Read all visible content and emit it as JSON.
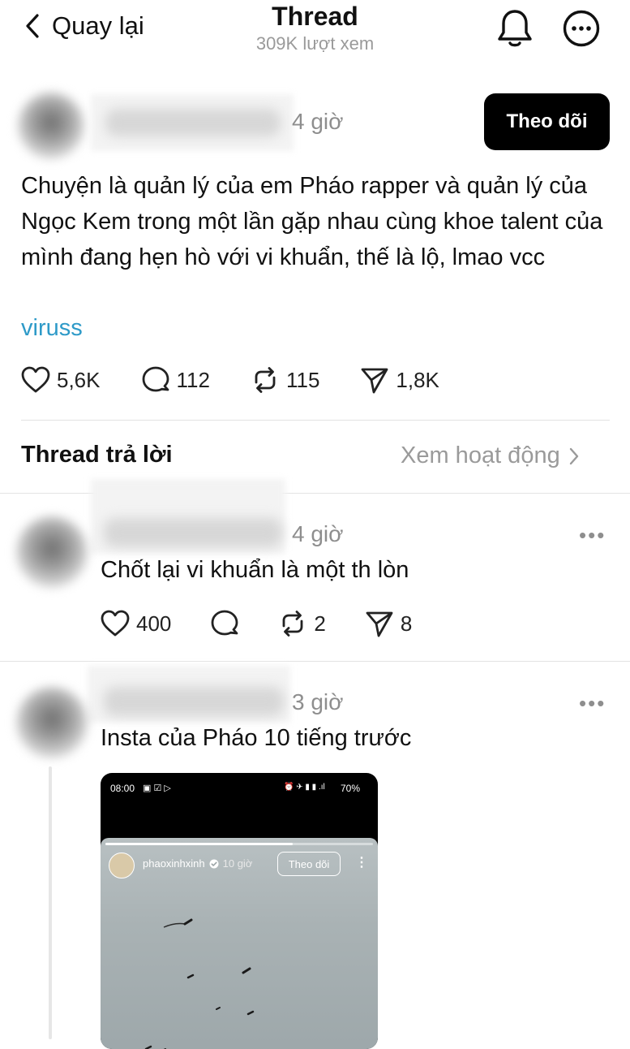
{
  "header": {
    "back_label": "Quay lại",
    "title": "Thread",
    "views": "309K lượt xem"
  },
  "post": {
    "time": "4 giờ",
    "follow_label": "Theo dõi",
    "text": "Chuyện là quản lý của em Pháo rapper và quản lý của Ngọc Kem trong một lần gặp nhau cùng khoe talent của mình đang hẹn hò với vi khuẩn, thế là lộ, lmao vcc",
    "tag": "viruss",
    "likes": "5,6K",
    "comments": "112",
    "reposts": "115",
    "shares": "1,8K"
  },
  "replies_section": {
    "title": "Thread trả lời",
    "see_activity": "Xem hoạt động"
  },
  "replies": [
    {
      "time": "4 giờ",
      "text": "Chốt lại vi khuẩn là một th lòn",
      "likes": "400",
      "reposts": "2",
      "shares": "8"
    },
    {
      "time": "3 giờ",
      "text": "Insta của Pháo 10 tiếng trước"
    }
  ],
  "embedded_screenshot": {
    "status_time": "08:00",
    "battery": "70%",
    "username": "phaoxinhxinh",
    "time": "10 giờ",
    "follow_label": "Theo dõi"
  },
  "colors": {
    "link": "#2e9ac8",
    "muted": "#8e8e8e",
    "button_bg": "#000000"
  }
}
